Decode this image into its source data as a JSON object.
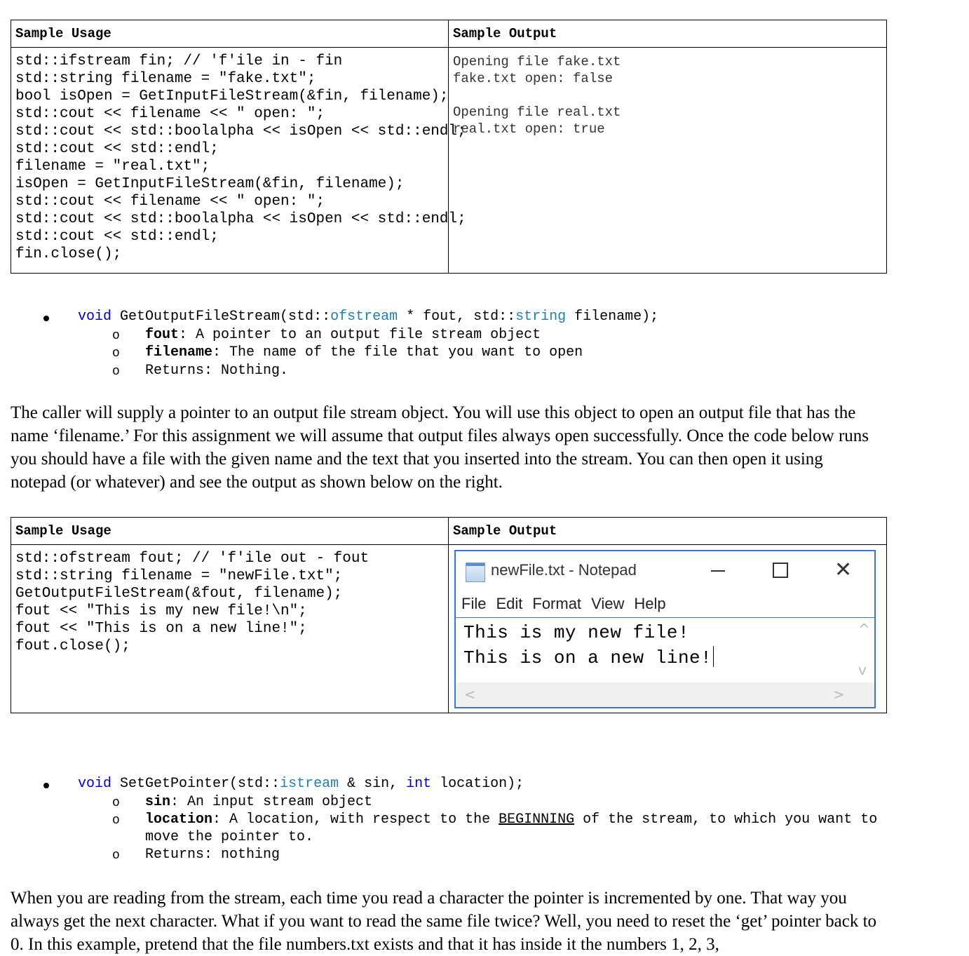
{
  "table1": {
    "header_left": "Sample Usage",
    "header_right": "Sample Output",
    "code": [
      "std::ifstream fin; // 'f'ile in - fin",
      "std::string filename = \"fake.txt\";",
      "bool isOpen = GetInputFileStream(&fin, filename);",
      "std::cout << filename << \" open: \";",
      "std::cout << std::boolalpha << isOpen << std::endl;",
      "std::cout << std::endl;",
      "filename = \"real.txt\";",
      "isOpen = GetInputFileStream(&fin, filename);",
      "std::cout << filename << \" open: \";",
      "std::cout << std::boolalpha << isOpen << std::endl;",
      "std::cout << std::endl;",
      "fin.close();"
    ],
    "output": [
      "Opening file fake.txt",
      "fake.txt open: false",
      "",
      "Opening file real.txt",
      "real.txt open: true"
    ]
  },
  "func1": {
    "sig_kw": "void",
    "sig_a": " GetOutputFileStream(std::",
    "sig_type1": "ofstream",
    "sig_b": " * fout, std::",
    "sig_type2": "string",
    "sig_c": " filename);",
    "params": [
      {
        "name": "fout",
        "desc": ": A pointer to an output file stream object"
      },
      {
        "name": "filename",
        "desc": ": The name of the file that you want to open"
      }
    ],
    "returns": "Returns: Nothing."
  },
  "para1": "The caller will supply a pointer to an output file stream object. You will use this object to open an output file that has the name ‘filename.’ For this assignment we will assume that output files always open successfully. Once the code below runs you should have a file with the given name and the text that you inserted into the stream. You can then open it using notepad (or whatever) and see the output as shown below on the right.",
  "table2": {
    "header_left": "Sample Usage",
    "header_right": "Sample Output",
    "code": [
      "std::ofstream fout; // 'f'ile out - fout",
      "std::string filename = \"newFile.txt\";",
      "GetOutputFileStream(&fout, filename);",
      "fout << \"This is my new file!\\n\";",
      "fout << \"This is on a new line!\";",
      "fout.close();"
    ],
    "notepad": {
      "title": "newFile.txt - Notepad",
      "menu": [
        "File",
        "Edit",
        "Format",
        "View",
        "Help"
      ],
      "lines": [
        "This is my new file!",
        "This is on a new line!"
      ],
      "close_glyph": "✕",
      "up_glyph": "^",
      "down_glyph": "v",
      "left_glyph": "<",
      "right_glyph": ">"
    }
  },
  "func2": {
    "sig_kw": "void",
    "sig_a": " SetGetPointer(std::",
    "sig_type1": "istream",
    "sig_b": " & sin, ",
    "sig_kw2": "int",
    "sig_c": " location);",
    "param1_name": "sin",
    "param1_desc": ": An input stream object",
    "param2_name": "location",
    "param2_desc_a": ": A location, with respect to the ",
    "param2_emph": "BEGINNING",
    "param2_desc_b": " of the stream, to which you want to",
    "param2_desc_c": "move the pointer to.",
    "returns": "Returns: nothing"
  },
  "para2": "When you are reading from the stream, each time you read a character the pointer is incremented by one. That way you always get the next character. What if you want to read the same file twice? Well, you need to reset the ‘get’ pointer back to 0. In this example, pretend that the file numbers.txt exists and that it has inside it the numbers 1, 2, 3,",
  "bullet_glyph": "o"
}
